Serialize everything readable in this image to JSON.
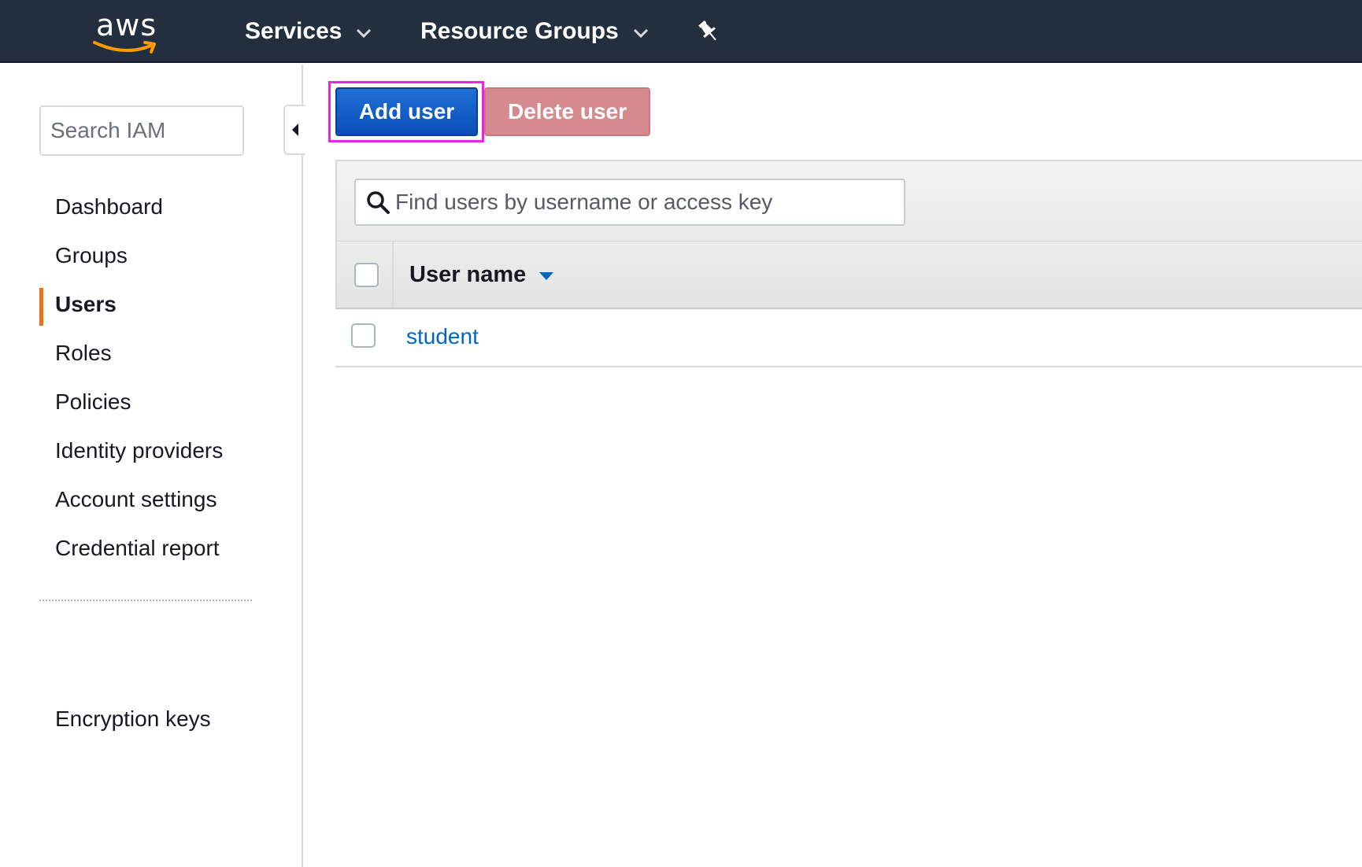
{
  "topbar": {
    "logo_text": "aws",
    "services_label": "Services",
    "resource_groups_label": "Resource Groups",
    "icons": {
      "services_caret": "chevron-down-icon",
      "resource_caret": "chevron-down-icon",
      "pin": "pin-icon"
    },
    "colors": {
      "background": "#232f3e",
      "logo_smile": "#ff9900"
    }
  },
  "sidebar": {
    "search_placeholder": "Search IAM",
    "items": [
      {
        "label": "Dashboard",
        "active": false
      },
      {
        "label": "Groups",
        "active": false
      },
      {
        "label": "Users",
        "active": true
      },
      {
        "label": "Roles",
        "active": false
      },
      {
        "label": "Policies",
        "active": false
      },
      {
        "label": "Identity providers",
        "active": false
      },
      {
        "label": "Account settings",
        "active": false
      },
      {
        "label": "Credential report",
        "active": false
      }
    ],
    "bottom_item": {
      "label": "Encryption keys"
    },
    "active_indicator_color": "#ec7211",
    "collapse_icon": "caret-left-icon"
  },
  "toolbar": {
    "add_user_label": "Add user",
    "delete_user_label": "Delete user",
    "delete_disabled": true,
    "highlight_color": "#e625e6"
  },
  "users_table": {
    "search_placeholder": "Find users by username or access key",
    "search_icon": "search-icon",
    "columns": [
      {
        "label": "User name",
        "sort_icon": "sort-descending-icon"
      }
    ],
    "rows": [
      {
        "user_name": "student"
      }
    ],
    "link_color": "#0066c0"
  }
}
